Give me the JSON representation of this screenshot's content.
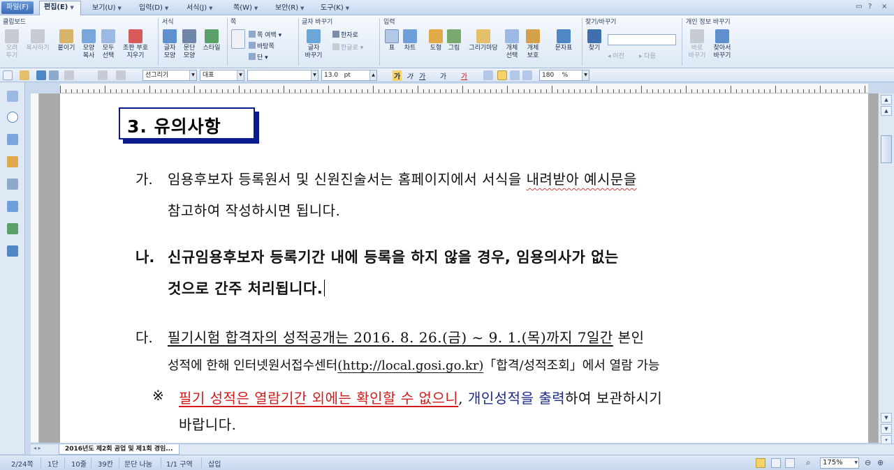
{
  "menu": {
    "file": "파일(F)",
    "edit": "편집(E)",
    "view": "보기(U)",
    "insert": "입력(D)",
    "format": "서식(J)",
    "page": "쪽(W)",
    "security": "보안(R)",
    "tools": "도구(K)",
    "help": "?",
    "close": "×"
  },
  "ribbon": {
    "groups": {
      "clipboard": "클립보드",
      "format": "서식",
      "page": "쪽",
      "char_change": "글자 바꾸기",
      "insert": "입력",
      "find_replace": "찾기/바꾸기",
      "privacy": "개인 정보 바꾸기"
    },
    "buttons": {
      "cut": "오려\n두기",
      "copy": "복사하기",
      "paste": "붙이기",
      "shape_copy": "모양\n복사",
      "select_all": "모두\n선택",
      "ctrl_symbol": "조판 부호\n지우기",
      "char_shape": "글자\n모양",
      "para_shape": "문단\n모양",
      "style": "스타일",
      "page_margin": "쪽 여백",
      "page_border": "바탕쪽",
      "column": "단",
      "char_conv": "글자\n바꾸기",
      "hanja": "한자로",
      "hangul": "한글로",
      "table": "표",
      "chart": "차트",
      "shape": "도형",
      "picture": "그림",
      "gallery": "그리기마당",
      "obj_select": "개체\n선택",
      "obj_protect": "개체\n보호",
      "symbol": "문자표",
      "find": "찾기",
      "prev": "이전",
      "next": "다음",
      "direct_change": "바로\n바꾸기",
      "find_change": "찾아서\n바꾸기"
    }
  },
  "toolbar": {
    "style_combo": "선그리기",
    "lang_combo": "대표",
    "font_combo": "",
    "size_combo": "13.0",
    "size_unit": "pt",
    "bold": "가",
    "italic": "가",
    "underline": "가",
    "strike": "가",
    "color": "가",
    "zoom_combo": "180",
    "zoom_unit": "%"
  },
  "document": {
    "heading": "3. 유의사항",
    "items": [
      {
        "marker": "가.",
        "line1_a": "임용후보자 등록원서 및 신원진술서는 홈페이지에서 서식을 ",
        "line1_b": "내려받아",
        "line1_c": " 예시문을",
        "line2": "참고하여 작성하시면 됩니다."
      },
      {
        "marker": "나.",
        "line1": "신규임용후보자 등록기간 내에 등록을 하지 않을 경우, 임용의사가 없는",
        "line2": "것으로 간주 처리됩니다."
      },
      {
        "marker": "다.",
        "line1_a": "필기시험 합격자의 성적공개는 2016. 8. 26.(금) ~ 9. 1.(목)까지 7일간",
        "line1_b": " 본인",
        "line2_a": "성적에 한해 인터넷원서접수센터",
        "line2_b": "(http://local.gosi.go.kr)",
        "line2_c": "「합격/성적조회」에서 열람 가능"
      }
    ],
    "note": {
      "marker": "※",
      "red": "필기 성적은 열람기간 외에는 확인할 수 없으니",
      "comma": ", ",
      "blue1": "개인성적을 ",
      "blue2": "출력",
      "rest": "하여 보관하시기",
      "line2": "바랍니다."
    }
  },
  "tab": {
    "name": "2016년도 제2회 공업 및 제1회 경임..."
  },
  "status": {
    "page": "2/24쪽",
    "column": "1단",
    "line": "10줄",
    "col": "39칸",
    "para_split": "문단 나눔",
    "section": "1/1 구역",
    "mode": "삽입",
    "zoom": "175%"
  },
  "colors": {
    "accent": "#0a1a8a",
    "red_text": "#d21a1a",
    "blue_text": "#1b2a8a"
  }
}
